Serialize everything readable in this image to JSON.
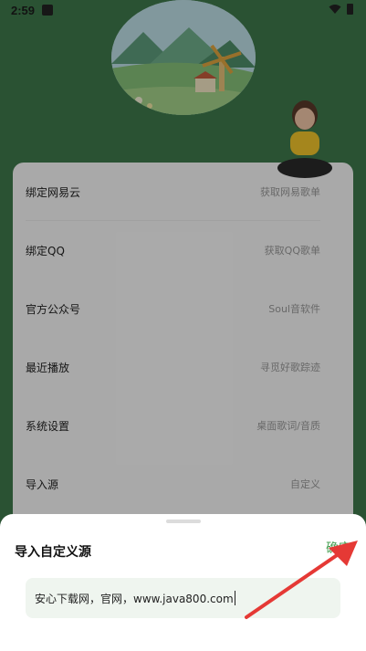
{
  "status_bar": {
    "time": "2:59"
  },
  "settings": {
    "items": [
      {
        "label": "绑定网易云",
        "hint": "获取网易歌单"
      },
      {
        "label": "绑定QQ",
        "hint": "获取QQ歌单"
      },
      {
        "label": "官方公众号",
        "hint": "Soul音软件"
      },
      {
        "label": "最近播放",
        "hint": "寻觅好歌踪迹"
      },
      {
        "label": "系统设置",
        "hint": "桌面歌词/音质"
      },
      {
        "label": "导入源",
        "hint": "自定义"
      }
    ]
  },
  "sheet": {
    "title": "导入自定义源",
    "confirm_label": "确定",
    "input_value": "安心下载网，官网，www.java800.com"
  },
  "colors": {
    "accent": "#49a155",
    "header_bg": "#3f7a4c",
    "arrow": "#e53935"
  }
}
